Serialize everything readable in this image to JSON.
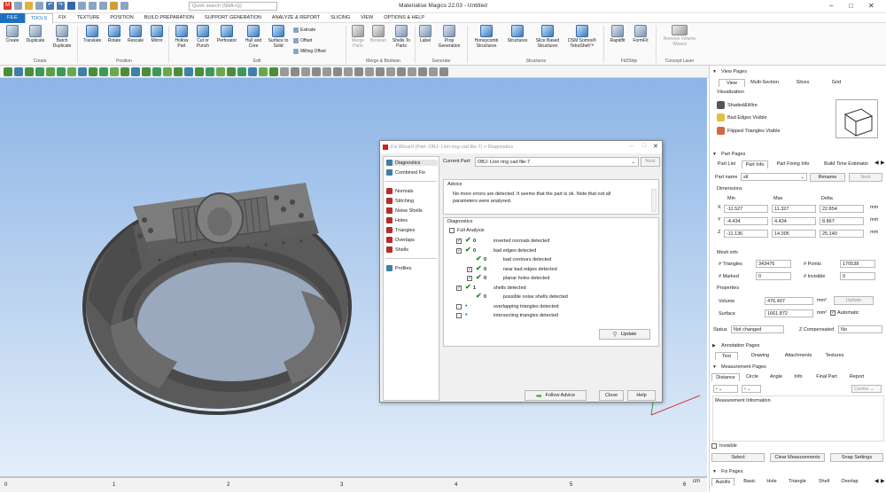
{
  "app": {
    "title": "Materialise Magics 22.03 - Untitled",
    "search_placeholder": "Quick search (Shift+Q)"
  },
  "menu": [
    "FILE",
    "TOOLS",
    "FIX",
    "TEXTURE",
    "POSITION",
    "BUILD PREPARATION",
    "SUPPORT GENERATION",
    "ANALYZE & REPORT",
    "SLICING",
    "VIEW",
    "OPTIONS & HELP"
  ],
  "ribbon": {
    "create": {
      "group": "Create",
      "buttons": [
        "Create",
        "Duplicate",
        "Batch Duplicate"
      ]
    },
    "position": {
      "group": "Position",
      "buttons": [
        "Translate",
        "Rotate",
        "Rescale",
        "Mirror"
      ]
    },
    "edit": {
      "group": "Edit",
      "buttons": [
        "Hollow Part",
        "Cut or Punch",
        "Perforator",
        "Hull and Core",
        "Surface to Solid"
      ],
      "small": [
        "Extrude",
        "Offset",
        "Milling Offset"
      ]
    },
    "merge": {
      "group": "Merge & Boolean",
      "buttons": [
        "Merge Parts",
        "Boolean",
        "Shells To Parts"
      ]
    },
    "generate": {
      "group": "Generate",
      "buttons": [
        "Label",
        "Prop Generation"
      ]
    },
    "structures": {
      "group": "Structures",
      "buttons": [
        "Honeycomb Structures",
        "Structures",
        "Slice Based Structures",
        "DSM Somos® TetraShell™"
      ]
    },
    "fit2ship": {
      "group": "Fit2Ship",
      "buttons": [
        "Rapidfit",
        "FormFit"
      ]
    },
    "concept": {
      "group": "Concept Laser",
      "buttons": [
        "Remove Volume Wizard"
      ],
      "top_label": "CONCEPT LASER"
    }
  },
  "ruler": {
    "ticks": [
      "0",
      "1",
      "2",
      "3",
      "4",
      "5",
      "6"
    ],
    "unit": "cm"
  },
  "dialog": {
    "title": "Fix Wizard (Part: OBJ- Lion ring cad file-7) > Diagnostics",
    "nav_top": [
      "Diagnostics",
      "Combined Fix"
    ],
    "nav_mid": [
      "Normals",
      "Stitching",
      "Noise Shells",
      "Holes",
      "Triangles",
      "Overlaps",
      "Shells"
    ],
    "nav_bottom": [
      "Profiles"
    ],
    "current_part_label": "Current Part:",
    "current_part": "OBJ- Lion ring cad file-7",
    "next": "Next",
    "advice_title": "Advice",
    "advice_text_1": "No more errors are detected. It seems that the part is ok. Note that not all",
    "advice_text_2": "parameters were analysed.",
    "diagnostics_title": "Diagnostics",
    "full_analysis": "Full Analysis",
    "rows": [
      {
        "label": "inverted normals detected",
        "count": "0",
        "level": 0,
        "checked": true,
        "status": "ok"
      },
      {
        "label": "bad edges detected",
        "count": "0",
        "level": 0,
        "checked": true,
        "status": "ok"
      },
      {
        "label": "bad contours detected",
        "count": "0",
        "level": 1,
        "checked": false,
        "status": "ok"
      },
      {
        "label": "near bad edges detected",
        "count": "0",
        "level": 1,
        "checked": true,
        "status": "ok"
      },
      {
        "label": "planar holes detected",
        "count": "0",
        "level": 1,
        "checked": true,
        "status": "ok"
      },
      {
        "label": "shells detected",
        "count": "1",
        "level": 0,
        "checked": true,
        "status": "ok"
      },
      {
        "label": "possible noise shells detected",
        "count": "0",
        "level": 1,
        "checked": false,
        "status": "ok"
      },
      {
        "label": "overlapping triangles detected",
        "count": "",
        "level": 0,
        "checked": false,
        "status": "none"
      },
      {
        "label": "intersecting triangles detected",
        "count": "",
        "level": 0,
        "checked": false,
        "status": "none"
      }
    ],
    "update": "Update",
    "follow_advice": "Follow Advice",
    "close": "Close",
    "help": "Help"
  },
  "right": {
    "view_pages": "View Pages",
    "view_tabs": [
      "View",
      "Multi-Section",
      "Slices",
      "Grid"
    ],
    "visualization": "Visualization",
    "vis_items": [
      "Shaded&Wire",
      "Bad Edges Visible",
      "Flipped Triangles Visible"
    ],
    "part_pages": "Part Pages",
    "part_tabs": [
      "Part List",
      "Part Info",
      "Part Fixing Info",
      "Build Time Estimatio"
    ],
    "part_name_label": "Part name",
    "part_name": "stl",
    "rename": "Rename",
    "next": "Next",
    "dimensions": "Dimensions",
    "dim_headers": [
      "Min",
      "Max",
      "Delta"
    ],
    "dims": [
      {
        "axis": "X",
        "min": "-11.527",
        "max": "11.327",
        "delta": "22.854",
        "unit": "mm"
      },
      {
        "axis": "Y",
        "min": "-4.434",
        "max": "4.434",
        "delta": "8.867",
        "unit": "mm"
      },
      {
        "axis": "Z",
        "min": "-11.136",
        "max": "14.005",
        "delta": "25.140",
        "unit": "mm"
      }
    ],
    "mesh_info": "Mesh info",
    "triangles_label": "# Triangles",
    "triangles": "343476",
    "points_label": "# Points",
    "points": "170538",
    "marked_label": "# Marked",
    "marked": "0",
    "invisible_label": "# Invisible",
    "invisible": "0",
    "properties": "Properties",
    "volume_label": "Volume",
    "volume": "476.497",
    "volume_unit": "mm³",
    "update": "Update",
    "surface_label": "Surface",
    "surface": "1661.872",
    "surface_unit": "mm²",
    "automatic": "Automatic",
    "status_label": "Status",
    "status": "Not changed",
    "zcomp_label": "Z Compensated",
    "zcomp": "No",
    "annotation_pages": "Annotation Pages",
    "annotation_tabs": [
      "Text",
      "Drawing",
      "Attachments",
      "Textures"
    ],
    "measurement_pages": "Measurement Pages",
    "measure_tabs": [
      "Distance",
      "Circle",
      "Angle",
      "Info",
      "Final Part",
      "Report"
    ],
    "center": "Center",
    "measurement_info": "Measurement Information",
    "invisible_chk": "Invisible",
    "select": "Select",
    "clear": "Clear Measurements",
    "snap": "Snap Settings",
    "fix_pages": "Fix Pages",
    "fix_tabs": [
      "Autofix",
      "Basic",
      "Hole",
      "Triangle",
      "Shell",
      "Overlap"
    ]
  },
  "colors": {
    "accent": "#1f6fbf",
    "viewport_top": "#8db5e6",
    "ok_green": "#1c8c1c"
  }
}
